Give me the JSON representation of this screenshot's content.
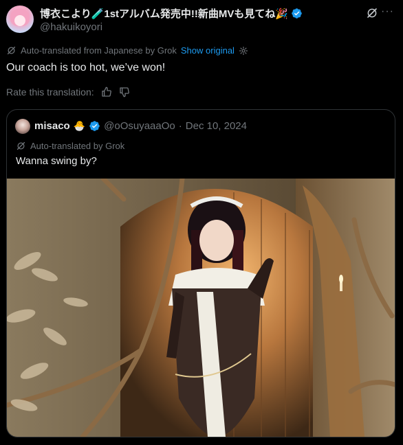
{
  "post": {
    "author_name": "博衣こより🧪1stアルバム発売中!!新曲MVも見てね🎉",
    "handle": "@hakuikoyori",
    "translation_note": "Auto-translated from Japanese by Grok",
    "show_original": "Show original",
    "text": "Our coach is too hot, we’ve won!",
    "rate_label": "Rate this translation:"
  },
  "quote": {
    "name": "misaco",
    "name_emoji": "🐣",
    "handle": "@oOsuyaaaOo",
    "separator": "·",
    "date": "Dec 10, 2024",
    "translation_note": "Auto-translated by Grok",
    "text": "Wanna swing by?"
  },
  "icons": {
    "verified": "verified-badge-icon",
    "grok": "grok-icon",
    "more": "more-icon",
    "settings": "gear-icon",
    "thumbs_up": "thumbs-up-icon",
    "thumbs_down": "thumbs-down-icon"
  },
  "colors": {
    "background": "#000000",
    "text": "#e7e9ea",
    "muted": "#71767b",
    "link": "#1d9bf0",
    "border": "#2f3336"
  }
}
